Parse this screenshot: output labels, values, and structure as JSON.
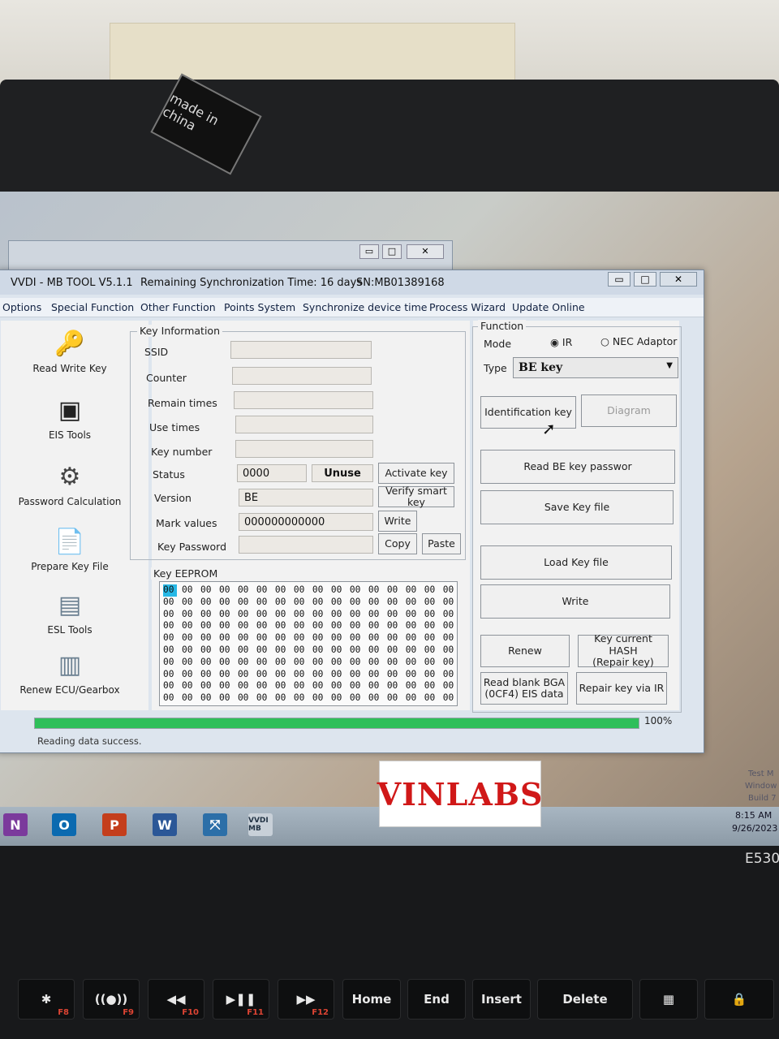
{
  "photo": {
    "sticker_text": "made in china",
    "model": "E530",
    "watermark": "VINLABS"
  },
  "bg_window": {
    "min": "▭",
    "max": "□",
    "close": "✕"
  },
  "window": {
    "app_name": "VVDI - MB TOOL V5.1.1",
    "sync_time": "Remaining Synchronization Time: 16 days",
    "serial": "SN:MB01389168",
    "controls": {
      "min": "▭",
      "max": "□",
      "close": "✕"
    }
  },
  "menu": [
    "Options",
    "Special Function",
    "Other Function",
    "Points System",
    "Synchronize device time",
    "Process Wizard",
    "Update Online"
  ],
  "sidebar": [
    {
      "label": "Read Write Key",
      "icon": "car-key-icon"
    },
    {
      "label": "EIS Tools",
      "icon": "eis-module-icon"
    },
    {
      "label": "Password Calculation",
      "icon": "password-gear-icon"
    },
    {
      "label": "Prepare Key File",
      "icon": "key-file-icon"
    },
    {
      "label": "ESL Tools",
      "icon": "esl-board-icon"
    },
    {
      "label": "Renew ECU/Gearbox",
      "icon": "ecu-icon"
    }
  ],
  "key_info": {
    "legend": "Key Information",
    "labels": [
      "SSID",
      "Counter",
      "Remain times",
      "Use times",
      "Key number",
      "Status",
      "Version",
      "Mark values",
      "Key Password"
    ],
    "status_value": "0000",
    "status_state": "Unuse",
    "version": "BE",
    "mark_values": "000000000000",
    "buttons": {
      "activate": "Activate key",
      "verify": "Verify smart key",
      "write": "Write",
      "copy": "Copy",
      "paste": "Paste"
    }
  },
  "eeprom": {
    "legend": "Key EEPROM",
    "rows": [
      [
        "00",
        "00",
        "00",
        "00",
        "00",
        "00",
        "00",
        "00",
        "00",
        "00",
        "00",
        "00",
        "00",
        "00",
        "00",
        "00"
      ],
      [
        "00",
        "00",
        "00",
        "00",
        "00",
        "00",
        "00",
        "00",
        "00",
        "00",
        "00",
        "00",
        "00",
        "00",
        "00",
        "00"
      ],
      [
        "00",
        "00",
        "00",
        "00",
        "00",
        "00",
        "00",
        "00",
        "00",
        "00",
        "00",
        "00",
        "00",
        "00",
        "00",
        "00"
      ],
      [
        "00",
        "00",
        "00",
        "00",
        "00",
        "00",
        "00",
        "00",
        "00",
        "00",
        "00",
        "00",
        "00",
        "00",
        "00",
        "00"
      ],
      [
        "00",
        "00",
        "00",
        "00",
        "00",
        "00",
        "00",
        "00",
        "00",
        "00",
        "00",
        "00",
        "00",
        "00",
        "00",
        "00"
      ],
      [
        "00",
        "00",
        "00",
        "00",
        "00",
        "00",
        "00",
        "00",
        "00",
        "00",
        "00",
        "00",
        "00",
        "00",
        "00",
        "00"
      ],
      [
        "00",
        "00",
        "00",
        "00",
        "00",
        "00",
        "00",
        "00",
        "00",
        "00",
        "00",
        "00",
        "00",
        "00",
        "00",
        "00"
      ],
      [
        "00",
        "00",
        "00",
        "00",
        "00",
        "00",
        "00",
        "00",
        "00",
        "00",
        "00",
        "00",
        "00",
        "00",
        "00",
        "00"
      ],
      [
        "00",
        "00",
        "00",
        "00",
        "00",
        "00",
        "00",
        "00",
        "00",
        "00",
        "00",
        "00",
        "00",
        "00",
        "00",
        "00"
      ],
      [
        "00",
        "00",
        "00",
        "00",
        "00",
        "00",
        "00",
        "00",
        "00",
        "00",
        "00",
        "00",
        "00",
        "00",
        "00",
        "00"
      ]
    ]
  },
  "function": {
    "legend": "Function",
    "mode_label": "Mode",
    "mode_ir": "IR",
    "mode_nec": "NEC Adaptor",
    "type_label": "Type",
    "type_value": "BE key",
    "buttons": {
      "identification": "Identification key",
      "diagram": "Diagram",
      "read_password": "Read BE key passwor",
      "save_key": "Save Key file",
      "load_key": "Load Key file",
      "write": "Write",
      "renew": "Renew",
      "key_hash_1": "Key current HASH",
      "key_hash_2": "(Repair key)",
      "read_bga_1": "Read blank BGA",
      "read_bga_2": "(0CF4) EIS data",
      "repair_ir": "Repair key via IR"
    }
  },
  "progress": {
    "value": 1.0,
    "label": "100%"
  },
  "status_text": "Reading data success.",
  "taskbar": {
    "apps": [
      {
        "letter": "N",
        "color": "#7b3a9c"
      },
      {
        "letter": "O",
        "color": "#0b6ab0"
      },
      {
        "letter": "P",
        "color": "#c43e1c"
      },
      {
        "letter": "W",
        "color": "#2b5797"
      }
    ],
    "app_label": "VVDI MB",
    "time": "8:15 AM",
    "date": "9/26/2023",
    "watermark": [
      "Test M",
      "Window",
      "Build 7"
    ]
  },
  "keys": [
    {
      "label": "✱",
      "fn": "F8"
    },
    {
      "label": "((●))",
      "fn": "F9"
    },
    {
      "label": "◀◀",
      "fn": "F10"
    },
    {
      "label": "▶❚❚",
      "fn": "F11"
    },
    {
      "label": "▶▶",
      "fn": "F12"
    },
    {
      "label": "Home",
      "fn": ""
    },
    {
      "label": "End",
      "fn": ""
    },
    {
      "label": "Insert",
      "fn": ""
    },
    {
      "label": "Delete",
      "fn": ""
    },
    {
      "label": "▦",
      "fn": ""
    },
    {
      "label": "🔒",
      "fn": ""
    }
  ]
}
